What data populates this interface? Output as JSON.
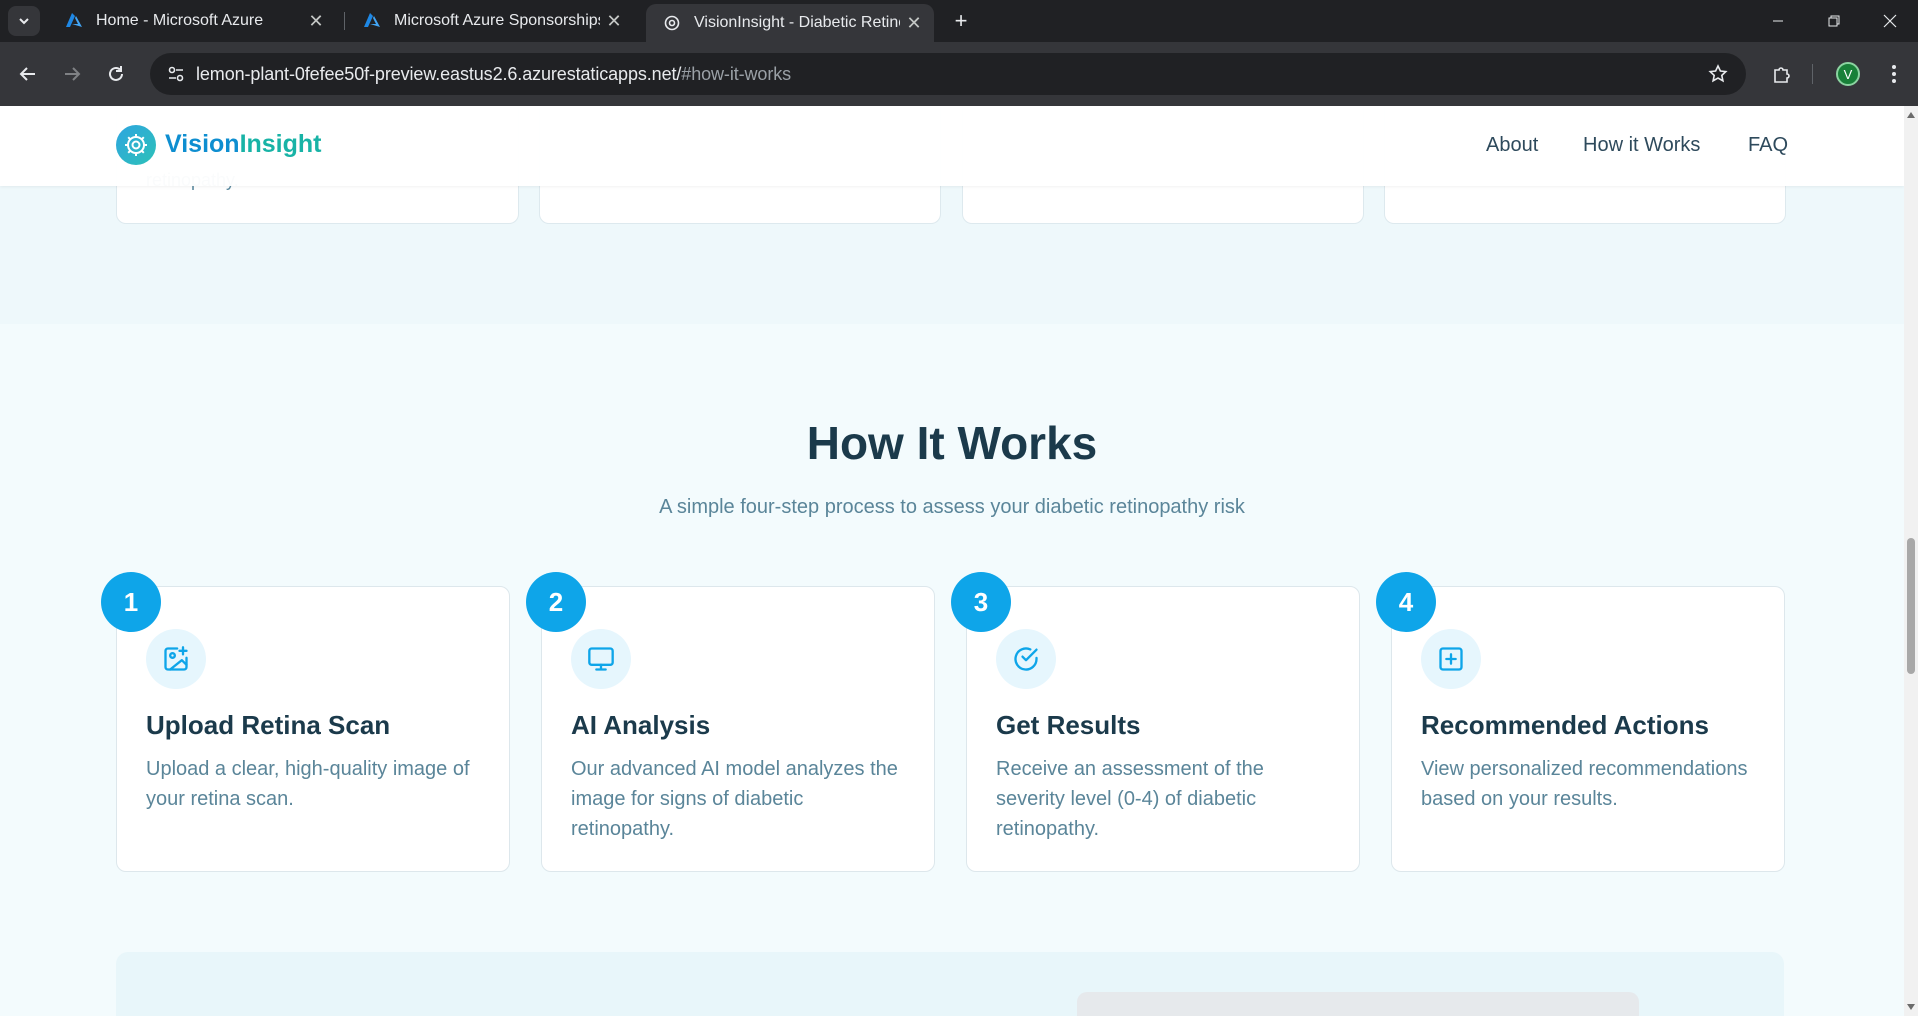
{
  "browser": {
    "tabs": [
      {
        "title": "Home - Microsoft Azure",
        "favicon": "azure-icon"
      },
      {
        "title": "Microsoft Azure Sponsorships |",
        "favicon": "azure-icon"
      },
      {
        "title": "VisionInsight - Diabetic Retinop",
        "favicon": "gear-icon",
        "active": true
      }
    ],
    "url_host": "lemon-plant-0fefee50f-preview.eastus2.6.azurestaticapps.net/",
    "url_path": "#how-it-works",
    "profile_initial": "V"
  },
  "header": {
    "logo_part1": "Vision",
    "logo_part2": "Insight",
    "nav": [
      "About",
      "How it Works",
      "FAQ"
    ]
  },
  "prev_section": {
    "card1_text": "retinopathy."
  },
  "how_it_works": {
    "title": "How It Works",
    "subtitle": "A simple four-step process to assess your diabetic retinopathy risk",
    "steps": [
      {
        "number": "1",
        "icon": "image-plus-icon",
        "title": "Upload Retina Scan",
        "desc": "Upload a clear, high-quality image of your retina scan."
      },
      {
        "number": "2",
        "icon": "monitor-icon",
        "title": "AI Analysis",
        "desc": "Our advanced AI model analyzes the image for signs of diabetic retinopathy."
      },
      {
        "number": "3",
        "icon": "check-circle-icon",
        "title": "Get Results",
        "desc": "Receive an assessment of the severity level (0-4) of diabetic retinopathy."
      },
      {
        "number": "4",
        "icon": "plus-square-icon",
        "title": "Recommended Actions",
        "desc": "View personalized recommendations based on your results."
      }
    ]
  },
  "colors": {
    "accent": "#0ea5e9",
    "heading": "#1b3a4b",
    "body_text": "#5a8599",
    "logo_blue": "#0e8ed0",
    "logo_teal": "#18b3a6"
  }
}
